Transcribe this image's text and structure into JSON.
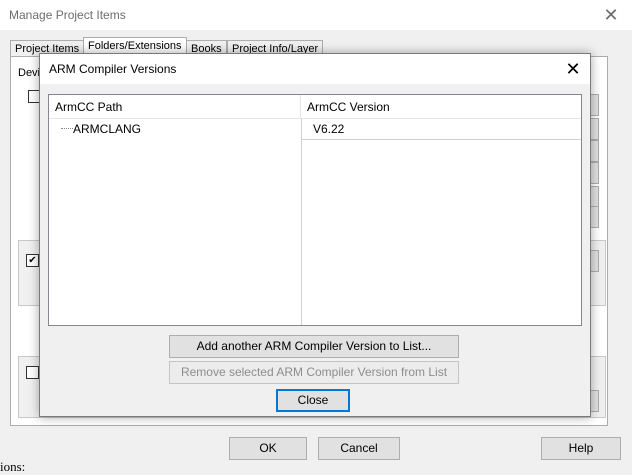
{
  "background_window": {
    "title": "Manage Project Items",
    "tabs": [
      "Project Items",
      "Folders/Extensions",
      "Books",
      "Project Info/Layer"
    ],
    "active_tab_index": 1,
    "label_partial": "Devi",
    "buttons": {
      "ok": "OK",
      "cancel": "Cancel",
      "help": "Help"
    },
    "behind_text": "ions:"
  },
  "dialog": {
    "title": "ARM Compiler Versions",
    "columns": {
      "path": "ArmCC Path",
      "version": "ArmCC Version"
    },
    "rows": [
      {
        "path": "ARMCLANG",
        "version": "V6.22"
      }
    ],
    "buttons": {
      "add": "Add another ARM Compiler Version to List...",
      "remove": "Remove selected ARM Compiler Version from List",
      "close": "Close"
    }
  },
  "colors": {
    "title_text_inactive": "#6d6d6d",
    "focus_border": "#0078d7",
    "disabled_text": "#8d8d8d"
  }
}
